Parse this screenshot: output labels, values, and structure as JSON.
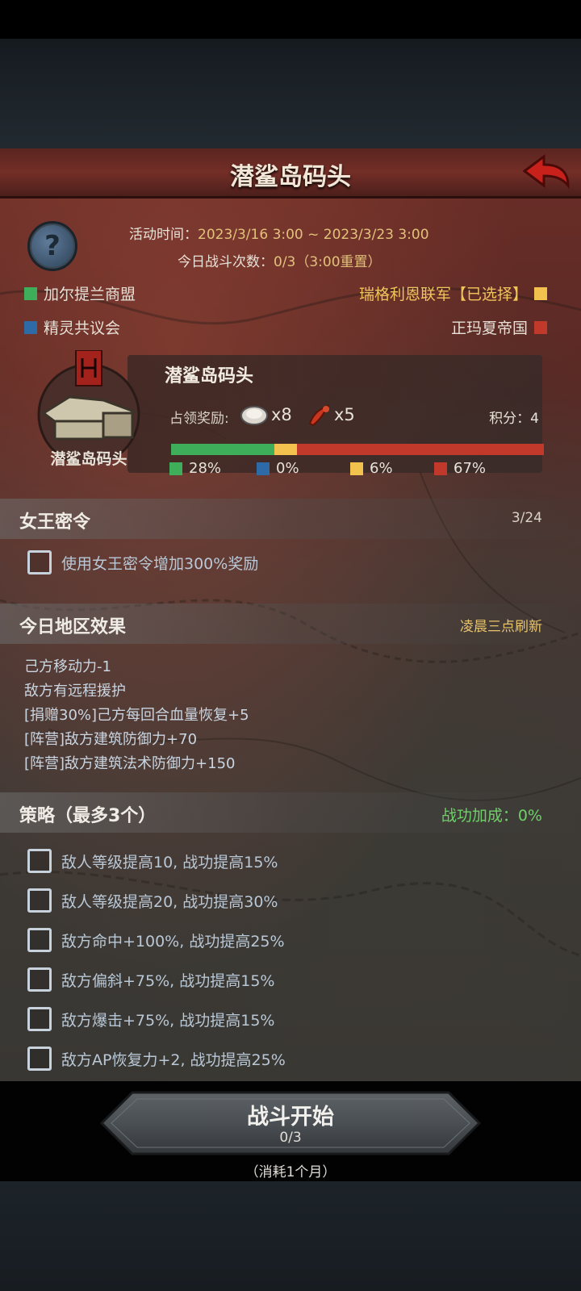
{
  "header": {
    "title": "潜鲨岛码头"
  },
  "info": {
    "activity_time_label": "活动时间：",
    "activity_time_value": "2023/3/16 3:00 ~ 2023/3/23 3:00",
    "battle_count_label": "今日战斗次数：",
    "battle_count_value": "0/3（3:00重置）"
  },
  "factions": {
    "left": [
      {
        "name": "加尔提兰商盟",
        "color": "#3fae5a"
      },
      {
        "name": "精灵共议会",
        "color": "#2e6aa6"
      }
    ],
    "right": [
      {
        "name": "瑞格利恩联军【已选择】",
        "color": "#f2c14e"
      },
      {
        "name": "正玛夏帝国",
        "color": "#c0392b"
      }
    ]
  },
  "location": {
    "icon_label": "潜鲨岛码头",
    "name": "潜鲨岛码头",
    "reward_label": "占领奖励:",
    "rewards": [
      {
        "icon": "oyster-icon",
        "count": "x8"
      },
      {
        "icon": "lobster-icon",
        "count": "x5"
      }
    ],
    "score": "积分：4",
    "distribution": [
      {
        "pct": 28,
        "label": "28%",
        "color": "#3fae5a"
      },
      {
        "pct": 0,
        "label": "0%",
        "color": "#2e6aa6"
      },
      {
        "pct": 6,
        "label": "6%",
        "color": "#f2c14e"
      },
      {
        "pct": 67,
        "label": "67%",
        "color": "#c0392b"
      }
    ]
  },
  "queen_order": {
    "title": "女王密令",
    "count": "3/24",
    "option": "使用女王密令增加300%奖励"
  },
  "regional_effects": {
    "title": "今日地区效果",
    "refresh_note": "凌晨三点刷新",
    "items": [
      "己方移动力-1",
      "敌方有远程援护",
      "[捐赠30%]己方每回合血量恢复+5",
      "[阵营]敌方建筑防御力+70",
      "[阵营]敌方建筑法术防御力+150"
    ]
  },
  "strategy": {
    "title": "策略（最多3个）",
    "bonus": "战功加成：0%",
    "options": [
      "敌人等级提高10, 战功提高15%",
      "敌人等级提高20, 战功提高30%",
      "敌方命中+100%, 战功提高25%",
      "敌方偏斜+75%, 战功提高15%",
      "敌方爆击+75%, 战功提高15%",
      "敌方AP恢复力+2, 战功提高25%"
    ]
  },
  "action": {
    "start_label": "战斗开始",
    "start_count": "0/3",
    "cost": "（消耗1个月）"
  },
  "colors": {
    "accent_green": "#6fd06a",
    "selected_yellow": "#f0c45c"
  }
}
